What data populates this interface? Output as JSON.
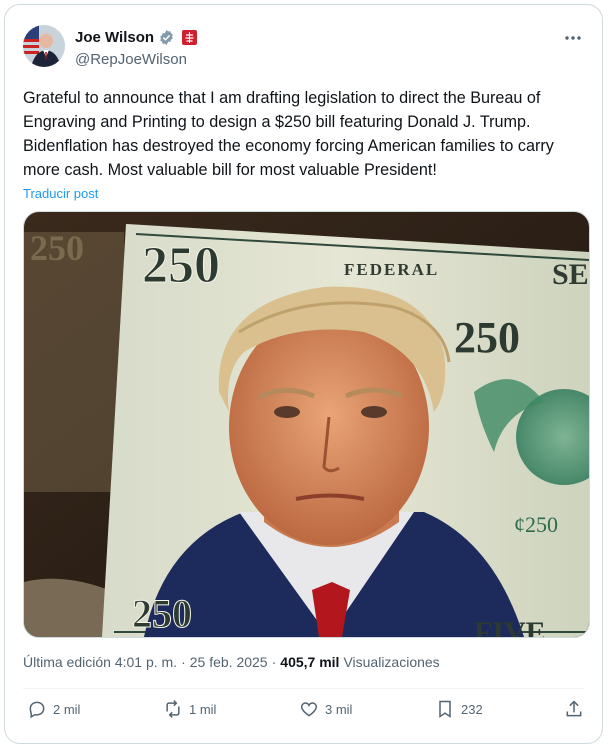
{
  "author": {
    "display_name": "Joe Wilson",
    "handle": "@RepJoeWilson",
    "verified_icon": "verified-badge-icon",
    "affiliation_icon": "congress-flag-icon"
  },
  "tweet": {
    "text": "Grateful to announce that I am drafting legislation to direct the Bureau of Engraving and Printing to design a $250 bill featuring Donald J. Trump. Bidenflation has destroyed the economy forcing American families to carry more cash. Most valuable bill for most valuable President!",
    "translate_label": "Traducir post"
  },
  "media": {
    "bill_denomination": "250",
    "bill_top_text": "FEDERAL",
    "bill_side_letters": "SE",
    "bill_small_value": "¢250",
    "bill_bottom_text": "FIVE"
  },
  "meta": {
    "edited_label": "Última edición 4:01 p. m.",
    "date": "25 feb. 2025",
    "separator": "·",
    "views_count": "405,7 mil",
    "views_label": "Visualizaciones"
  },
  "actions": {
    "replies": "2 mil",
    "reposts": "1 mil",
    "likes": "3 mil",
    "bookmarks": "232"
  },
  "colors": {
    "accent": "#1d9bf0",
    "text": "#0f1419",
    "muted": "#536471",
    "border": "#cfd9de"
  }
}
